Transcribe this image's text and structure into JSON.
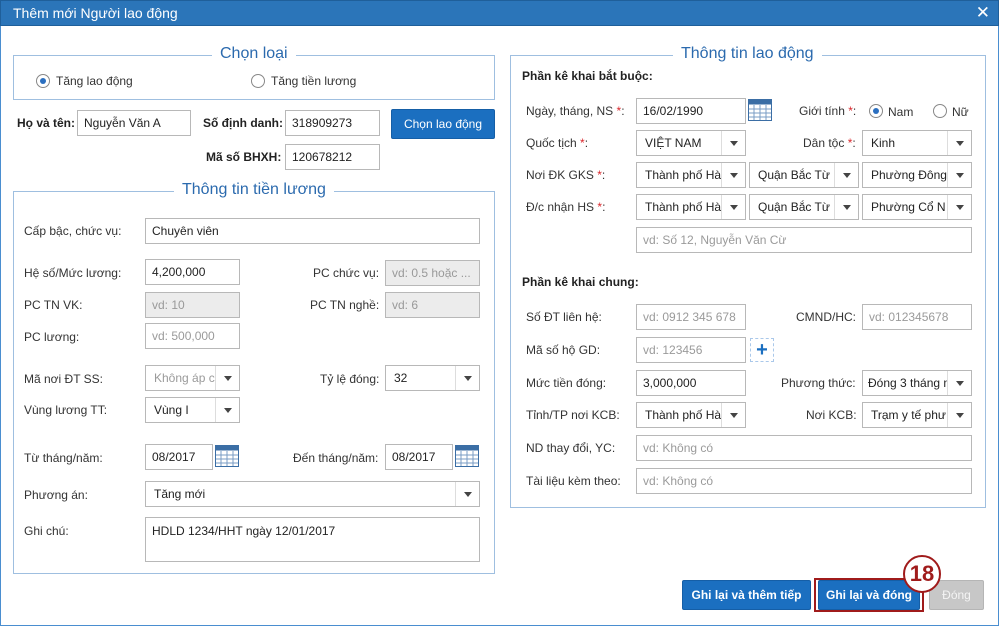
{
  "dialog": {
    "title": "Thêm mới Người lao động"
  },
  "chon_loai": {
    "legend": "Chọn loại",
    "options": [
      {
        "label": "Tăng lao động",
        "selected": true
      },
      {
        "label": "Tăng tiền lương",
        "selected": false
      }
    ]
  },
  "person": {
    "ho_ten_label": "Họ và tên:",
    "ho_ten_value": "Nguyễn Văn A",
    "so_dinh_danh_label": "Số định danh:",
    "so_dinh_danh_value": "318909273",
    "ma_bhxh_label": "Mã số BHXH:",
    "ma_bhxh_value": "120678212",
    "chon_button": "Chọn lao động"
  },
  "tien_luong": {
    "legend": "Thông tin tiền lương",
    "cap_bac_label": "Cấp bậc, chức vụ:",
    "cap_bac_value": "Chuyên viên",
    "he_so_label": "Hệ số/Mức lương:",
    "he_so_value": "4,200,000",
    "pc_chuc_vu_label": "PC chức vụ:",
    "pc_chuc_vu_ph": "vd: 0.5 hoặc ...",
    "pc_tn_vk_label": "PC TN VK:",
    "pc_tn_vk_ph": "vd: 10",
    "pc_tn_nghe_label": "PC TN nghề:",
    "pc_tn_nghe_ph": "vd: 6",
    "pc_luong_label": "PC lương:",
    "pc_luong_ph": "vd: 500,000",
    "ma_noi_label": "Mã nơi ĐT SS:",
    "ma_noi_ph": "Không áp c",
    "ty_le_label": "Tỷ lệ đóng:",
    "ty_le_value": "32",
    "vung_label": "Vùng lương TT:",
    "vung_value": "Vùng I",
    "tu_thang_label": "Từ tháng/năm:",
    "tu_thang_value": "08/2017",
    "den_thang_label": "Đến tháng/năm:",
    "den_thang_value": "08/2017",
    "phuong_an_label": "Phương án:",
    "phuong_an_value": "Tăng mới",
    "ghi_chu_label": "Ghi chú:",
    "ghi_chu_value": "HDLD 1234/HHT ngày 12/01/2017"
  },
  "lao_dong": {
    "legend": "Thông tin lao động",
    "bat_buoc_title": "Phần kê khai bắt buộc:",
    "ngay_sinh_label": "Ngày, tháng, NS",
    "ngay_sinh_value": "16/02/1990",
    "gioi_tinh_label": "Giới tính",
    "gioi_tinh_options": [
      {
        "label": "Nam",
        "selected": true
      },
      {
        "label": "Nữ",
        "selected": false
      }
    ],
    "quoc_tich_label": "Quốc tịch",
    "quoc_tich_value": "VIỆT NAM",
    "dan_toc_label": "Dân tộc",
    "dan_toc_value": "Kinh",
    "noi_dk_label": "Nơi ĐK GKS",
    "noi_dk_values": [
      "Thành phố Hà",
      "Quận Bắc Từ",
      "Phường Đông"
    ],
    "dc_nhan_label": "Đ/c nhận HS",
    "dc_nhan_values": [
      "Thành phố Hà",
      "Quận Bắc Từ",
      "Phường Cổ N"
    ],
    "dia_chi_ph": "vd: Số 12, Nguyễn Văn Cừ",
    "chung_title": "Phần kê khai chung:",
    "sdt_label": "Số ĐT liên hệ:",
    "sdt_ph": "vd: 0912 345 678",
    "cmnd_label": "CMND/HC:",
    "cmnd_ph": "vd: 012345678",
    "ma_ho_label": "Mã số hộ GD:",
    "ma_ho_ph": "vd: 123456",
    "muc_tien_label": "Mức tiền đóng:",
    "muc_tien_value": "3,000,000",
    "phuong_thuc_label": "Phương thức:",
    "phuong_thuc_value": "Đóng 3 tháng m",
    "tinh_label": "Tỉnh/TP nơi KCB:",
    "tinh_value": "Thành phố Hà",
    "noi_kcb_label": "Nơi KCB:",
    "noi_kcb_value": "Trạm y tế phư",
    "nd_label": "ND thay đổi, YC:",
    "nd_ph": "vd: Không có",
    "tai_lieu_label": "Tài liệu kèm theo:",
    "tai_lieu_ph": "vd: Không có"
  },
  "footer": {
    "save_continue": "Ghi lại và thêm tiếp",
    "save_close": "Ghi lại và đóng",
    "close": "Đóng",
    "step_number": "18"
  },
  "colors": {
    "title_bar": "#2b75b9",
    "primary_button": "#1b6fc0",
    "highlight": "#a01b1b",
    "legend": "#2b6aae"
  }
}
